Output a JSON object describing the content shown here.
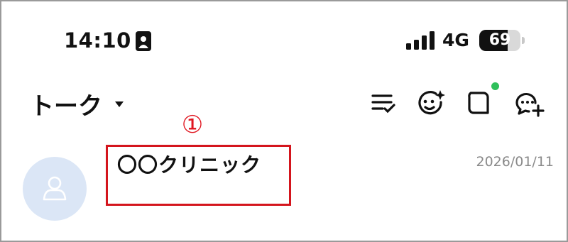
{
  "status_bar": {
    "time": "14:10",
    "network": "4G",
    "battery_percent": "69",
    "battery_level": 0.69
  },
  "header": {
    "title": "トーク",
    "icons": [
      "sort-checklist-icon",
      "face-sparkle-icon",
      "square-chat-icon",
      "add-chat-icon"
    ],
    "notification_dot_color": "#2fc05b"
  },
  "annotation": {
    "marker": "①",
    "color": "#d4151d"
  },
  "chats": [
    {
      "name": "〇〇クリニック",
      "date": "2026/01/11"
    }
  ]
}
